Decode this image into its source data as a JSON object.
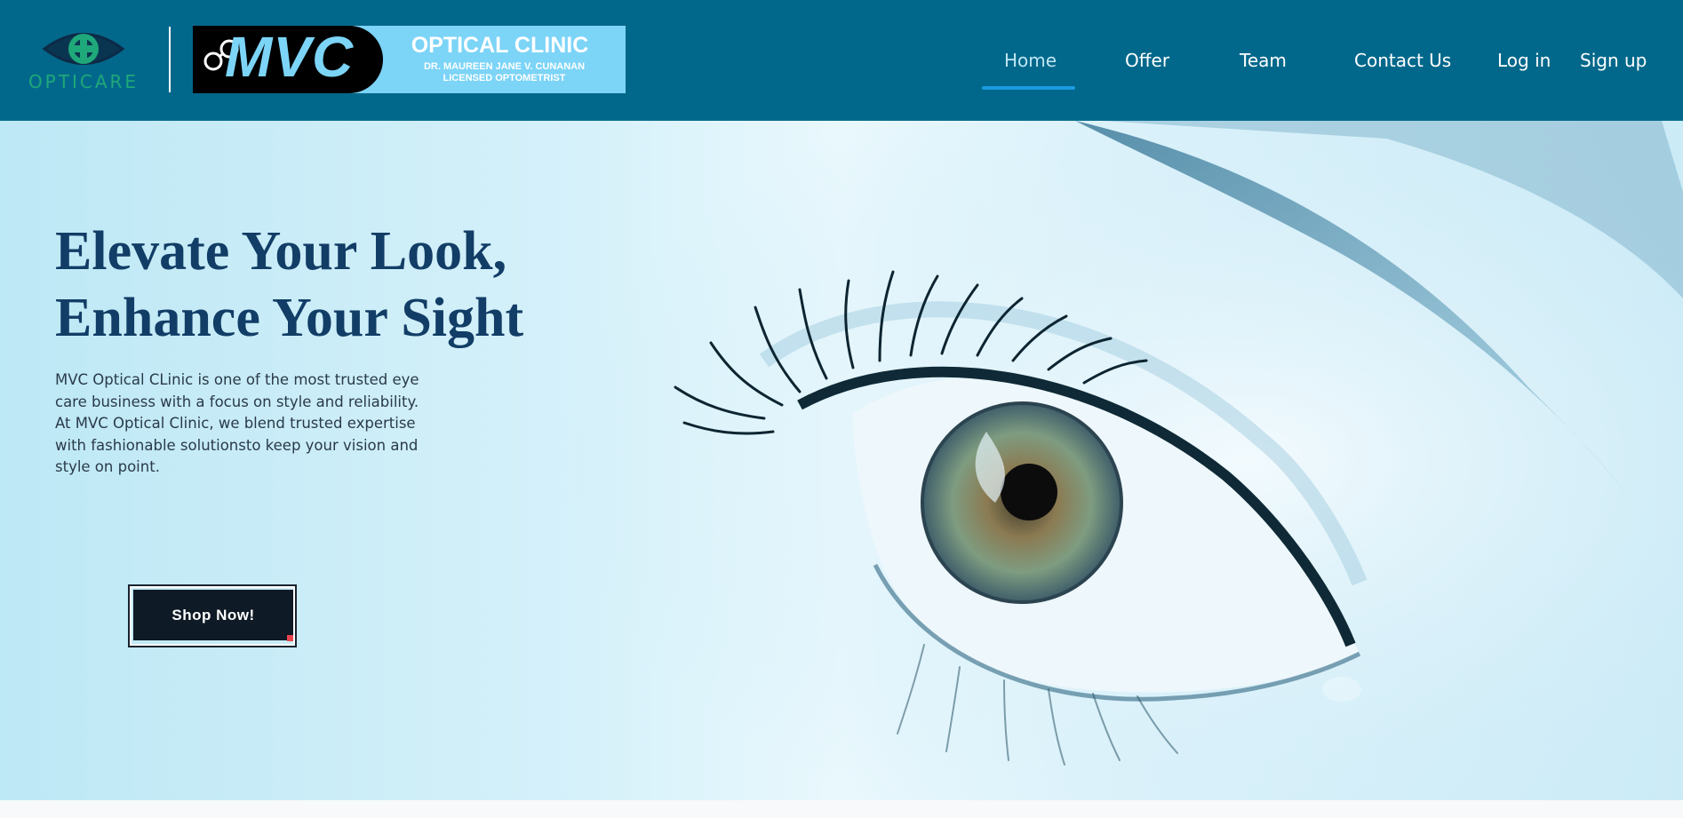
{
  "brand": {
    "name": "OPTICARE",
    "colors": {
      "header": "#02688b",
      "logo": "#1fa87a",
      "accent": "#1b9be0",
      "title": "#123d66",
      "button": "#0e1a26"
    }
  },
  "banner": {
    "mvc": "MVC",
    "title": "OPTICAL CLINIC",
    "doctor": "DR. MAUREEN JANE V. CUNANAN",
    "credential": "LICENSED OPTOMETRIST"
  },
  "nav": {
    "items": [
      {
        "label": "Home",
        "active": true
      },
      {
        "label": "Offer"
      },
      {
        "label": "Team"
      },
      {
        "label": "Contact Us"
      },
      {
        "label": "Log in"
      },
      {
        "label": "Sign up"
      }
    ]
  },
  "hero": {
    "title_line1": "Elevate Your Look,",
    "title_line2": "Enhance Your Sight",
    "description": "MVC Optical CLinic is one of the most trusted eye care business with a focus on style and reliability. At MVC Optical Clinic, we blend trusted expertise with fashionable solutionsto keep your vision and style on point.",
    "cta_label": "Shop Now!"
  }
}
